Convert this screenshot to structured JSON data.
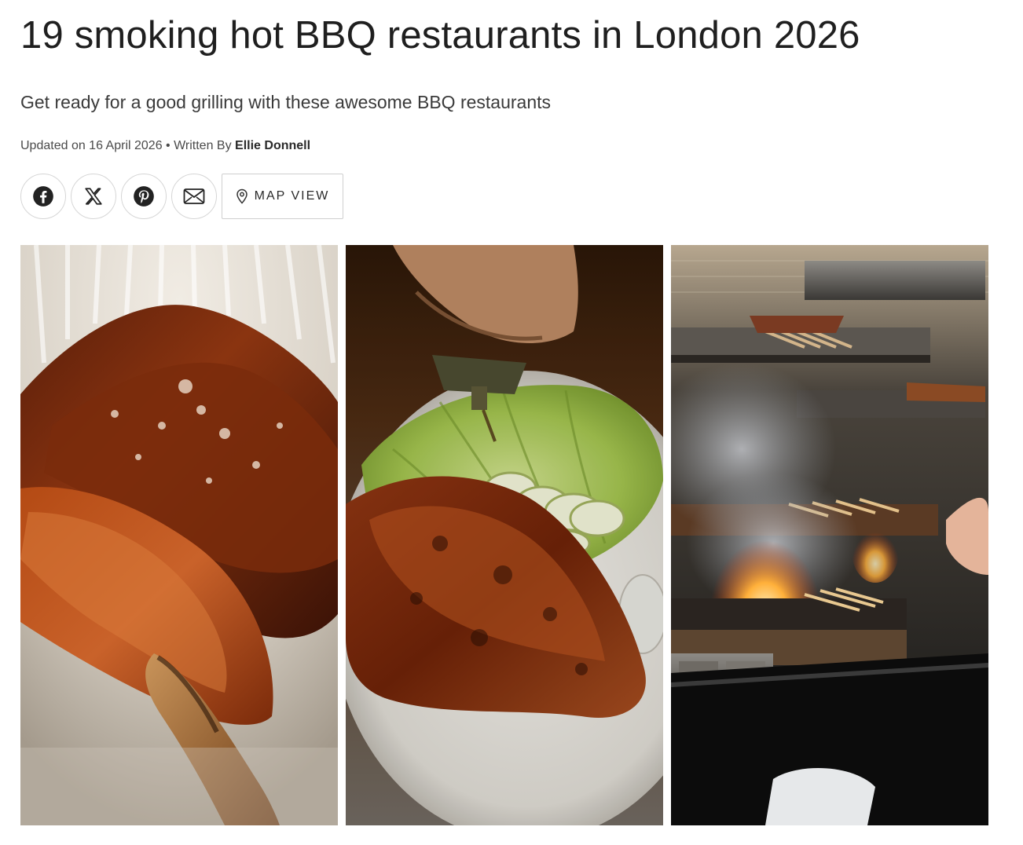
{
  "article": {
    "title": "19 smoking hot BBQ restaurants in London 2026",
    "subtitle": "Get ready for a good grilling with these awesome BBQ restaurants",
    "byline": {
      "updated_prefix": "Updated on 16 April 2026 • Written By ",
      "author": "Ellie Donnell"
    }
  },
  "share": {
    "buttons": [
      {
        "icon": "facebook-icon"
      },
      {
        "icon": "x-icon"
      },
      {
        "icon": "pinterest-icon"
      },
      {
        "icon": "email-icon"
      }
    ],
    "map_label": "MAP VIEW",
    "map_icon": "map-pin-icon"
  },
  "gallery": {
    "images": [
      {
        "subject": "glazed-bbq-ribs"
      },
      {
        "subject": "grilled-chicken-with-lettuce"
      },
      {
        "subject": "open-grill-kitchen"
      }
    ]
  },
  "colors": {
    "text": "#1f1f1f",
    "border": "#d6d6d6"
  }
}
